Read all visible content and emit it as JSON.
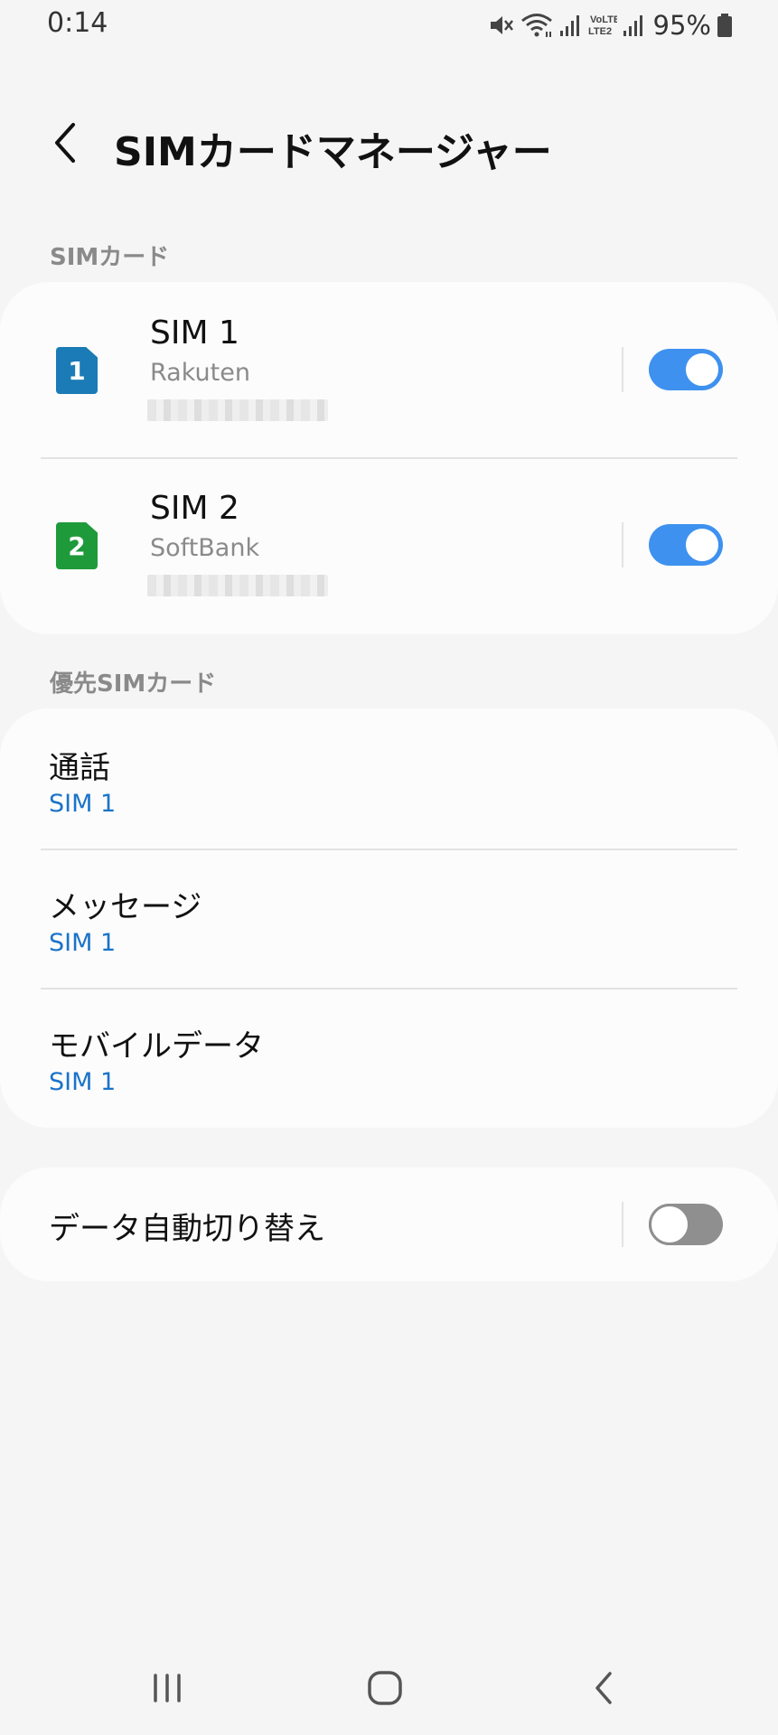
{
  "status": {
    "time": "0:14",
    "battery": "95%",
    "icons": [
      "mute-icon",
      "wifi-icon",
      "signal-icon",
      "volte-icon",
      "signal-icon",
      "battery-icon"
    ]
  },
  "header": {
    "title": "SIMカードマネージャー",
    "back_icon": "back-chevron-icon"
  },
  "sim_section": {
    "label": "SIMカード",
    "sims": [
      {
        "badge": "1",
        "name": "SIM 1",
        "carrier": "Rakuten",
        "enabled": true,
        "color": "#1a7bb6"
      },
      {
        "badge": "2",
        "name": "SIM 2",
        "carrier": "SoftBank",
        "enabled": true,
        "color": "#1e9a3b"
      }
    ]
  },
  "preferred_section": {
    "label": "優先SIMカード",
    "items": [
      {
        "title": "通話",
        "value": "SIM 1"
      },
      {
        "title": "メッセージ",
        "value": "SIM 1"
      },
      {
        "title": "モバイルデータ",
        "value": "SIM 1"
      }
    ]
  },
  "auto_switch": {
    "label": "データ自動切り替え",
    "enabled": false
  },
  "colors": {
    "accent": "#3e91ef",
    "value_text": "#1a73c9",
    "background": "#f5f5f5"
  },
  "navbar": {
    "icons": [
      "recent-apps-icon",
      "home-icon",
      "back-icon"
    ]
  }
}
